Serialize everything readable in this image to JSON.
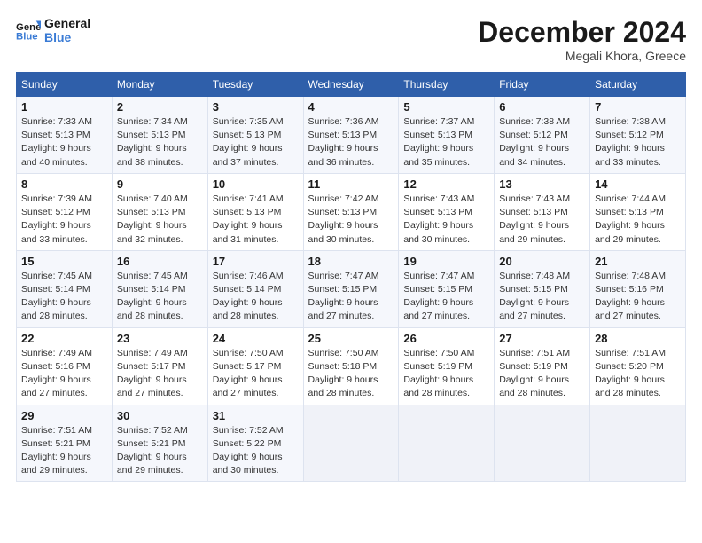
{
  "header": {
    "logo_line1": "General",
    "logo_line2": "Blue",
    "title": "December 2024",
    "subtitle": "Megali Khora, Greece"
  },
  "weekdays": [
    "Sunday",
    "Monday",
    "Tuesday",
    "Wednesday",
    "Thursday",
    "Friday",
    "Saturday"
  ],
  "weeks": [
    [
      {
        "day": "1",
        "sunrise": "Sunrise: 7:33 AM",
        "sunset": "Sunset: 5:13 PM",
        "daylight": "Daylight: 9 hours and 40 minutes."
      },
      {
        "day": "2",
        "sunrise": "Sunrise: 7:34 AM",
        "sunset": "Sunset: 5:13 PM",
        "daylight": "Daylight: 9 hours and 38 minutes."
      },
      {
        "day": "3",
        "sunrise": "Sunrise: 7:35 AM",
        "sunset": "Sunset: 5:13 PM",
        "daylight": "Daylight: 9 hours and 37 minutes."
      },
      {
        "day": "4",
        "sunrise": "Sunrise: 7:36 AM",
        "sunset": "Sunset: 5:13 PM",
        "daylight": "Daylight: 9 hours and 36 minutes."
      },
      {
        "day": "5",
        "sunrise": "Sunrise: 7:37 AM",
        "sunset": "Sunset: 5:13 PM",
        "daylight": "Daylight: 9 hours and 35 minutes."
      },
      {
        "day": "6",
        "sunrise": "Sunrise: 7:38 AM",
        "sunset": "Sunset: 5:12 PM",
        "daylight": "Daylight: 9 hours and 34 minutes."
      },
      {
        "day": "7",
        "sunrise": "Sunrise: 7:38 AM",
        "sunset": "Sunset: 5:12 PM",
        "daylight": "Daylight: 9 hours and 33 minutes."
      }
    ],
    [
      {
        "day": "8",
        "sunrise": "Sunrise: 7:39 AM",
        "sunset": "Sunset: 5:12 PM",
        "daylight": "Daylight: 9 hours and 33 minutes."
      },
      {
        "day": "9",
        "sunrise": "Sunrise: 7:40 AM",
        "sunset": "Sunset: 5:13 PM",
        "daylight": "Daylight: 9 hours and 32 minutes."
      },
      {
        "day": "10",
        "sunrise": "Sunrise: 7:41 AM",
        "sunset": "Sunset: 5:13 PM",
        "daylight": "Daylight: 9 hours and 31 minutes."
      },
      {
        "day": "11",
        "sunrise": "Sunrise: 7:42 AM",
        "sunset": "Sunset: 5:13 PM",
        "daylight": "Daylight: 9 hours and 30 minutes."
      },
      {
        "day": "12",
        "sunrise": "Sunrise: 7:43 AM",
        "sunset": "Sunset: 5:13 PM",
        "daylight": "Daylight: 9 hours and 30 minutes."
      },
      {
        "day": "13",
        "sunrise": "Sunrise: 7:43 AM",
        "sunset": "Sunset: 5:13 PM",
        "daylight": "Daylight: 9 hours and 29 minutes."
      },
      {
        "day": "14",
        "sunrise": "Sunrise: 7:44 AM",
        "sunset": "Sunset: 5:13 PM",
        "daylight": "Daylight: 9 hours and 29 minutes."
      }
    ],
    [
      {
        "day": "15",
        "sunrise": "Sunrise: 7:45 AM",
        "sunset": "Sunset: 5:14 PM",
        "daylight": "Daylight: 9 hours and 28 minutes."
      },
      {
        "day": "16",
        "sunrise": "Sunrise: 7:45 AM",
        "sunset": "Sunset: 5:14 PM",
        "daylight": "Daylight: 9 hours and 28 minutes."
      },
      {
        "day": "17",
        "sunrise": "Sunrise: 7:46 AM",
        "sunset": "Sunset: 5:14 PM",
        "daylight": "Daylight: 9 hours and 28 minutes."
      },
      {
        "day": "18",
        "sunrise": "Sunrise: 7:47 AM",
        "sunset": "Sunset: 5:15 PM",
        "daylight": "Daylight: 9 hours and 27 minutes."
      },
      {
        "day": "19",
        "sunrise": "Sunrise: 7:47 AM",
        "sunset": "Sunset: 5:15 PM",
        "daylight": "Daylight: 9 hours and 27 minutes."
      },
      {
        "day": "20",
        "sunrise": "Sunrise: 7:48 AM",
        "sunset": "Sunset: 5:15 PM",
        "daylight": "Daylight: 9 hours and 27 minutes."
      },
      {
        "day": "21",
        "sunrise": "Sunrise: 7:48 AM",
        "sunset": "Sunset: 5:16 PM",
        "daylight": "Daylight: 9 hours and 27 minutes."
      }
    ],
    [
      {
        "day": "22",
        "sunrise": "Sunrise: 7:49 AM",
        "sunset": "Sunset: 5:16 PM",
        "daylight": "Daylight: 9 hours and 27 minutes."
      },
      {
        "day": "23",
        "sunrise": "Sunrise: 7:49 AM",
        "sunset": "Sunset: 5:17 PM",
        "daylight": "Daylight: 9 hours and 27 minutes."
      },
      {
        "day": "24",
        "sunrise": "Sunrise: 7:50 AM",
        "sunset": "Sunset: 5:17 PM",
        "daylight": "Daylight: 9 hours and 27 minutes."
      },
      {
        "day": "25",
        "sunrise": "Sunrise: 7:50 AM",
        "sunset": "Sunset: 5:18 PM",
        "daylight": "Daylight: 9 hours and 28 minutes."
      },
      {
        "day": "26",
        "sunrise": "Sunrise: 7:50 AM",
        "sunset": "Sunset: 5:19 PM",
        "daylight": "Daylight: 9 hours and 28 minutes."
      },
      {
        "day": "27",
        "sunrise": "Sunrise: 7:51 AM",
        "sunset": "Sunset: 5:19 PM",
        "daylight": "Daylight: 9 hours and 28 minutes."
      },
      {
        "day": "28",
        "sunrise": "Sunrise: 7:51 AM",
        "sunset": "Sunset: 5:20 PM",
        "daylight": "Daylight: 9 hours and 28 minutes."
      }
    ],
    [
      {
        "day": "29",
        "sunrise": "Sunrise: 7:51 AM",
        "sunset": "Sunset: 5:21 PM",
        "daylight": "Daylight: 9 hours and 29 minutes."
      },
      {
        "day": "30",
        "sunrise": "Sunrise: 7:52 AM",
        "sunset": "Sunset: 5:21 PM",
        "daylight": "Daylight: 9 hours and 29 minutes."
      },
      {
        "day": "31",
        "sunrise": "Sunrise: 7:52 AM",
        "sunset": "Sunset: 5:22 PM",
        "daylight": "Daylight: 9 hours and 30 minutes."
      },
      null,
      null,
      null,
      null
    ]
  ]
}
